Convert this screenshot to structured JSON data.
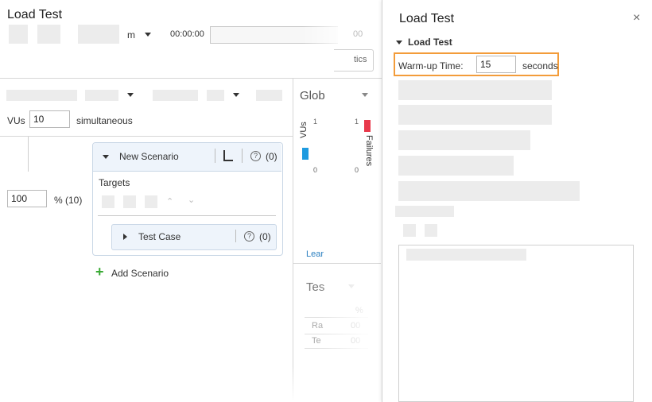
{
  "left": {
    "title": "Load Test",
    "unit_m": "m",
    "time": "00:00:00",
    "time_tail": "00",
    "button_partial": "tics",
    "vus_label": "VUs",
    "vus_value": "10",
    "simultaneous": "simultaneous",
    "percent_value": "100",
    "percent_label": "% (10)",
    "scenario": {
      "name": "New Scenario",
      "count": "(0)",
      "targets": "Targets",
      "test_case": {
        "name": "Test Case",
        "count": "(0)"
      }
    },
    "add_scenario": "Add Scenario"
  },
  "middle": {
    "global_partial": "Glob",
    "vus_axis": "VUs",
    "failures_axis": "Failures",
    "tick_top_left": "1",
    "tick_bottom_left": "0",
    "tick_top_right": "1",
    "tick_bottom_right": "0",
    "learn_partial": "Lear",
    "tes_partial": "Tes",
    "pct": "%",
    "row1": "Ra",
    "row1_val": "00",
    "row2": "Te",
    "row2_val": "00"
  },
  "right": {
    "title": "Load Test",
    "close": "×",
    "section": "Load Test",
    "warmup_label": "Warm-up Time:",
    "warmup_value": "15",
    "warmup_unit": "seconds"
  },
  "colors": {
    "highlight": "#f39c3a",
    "vus_bar": "#1e9be0",
    "failures_bar": "#e8394b",
    "add_icon": "#3aaa35",
    "learn_link": "#2a7fc0"
  }
}
